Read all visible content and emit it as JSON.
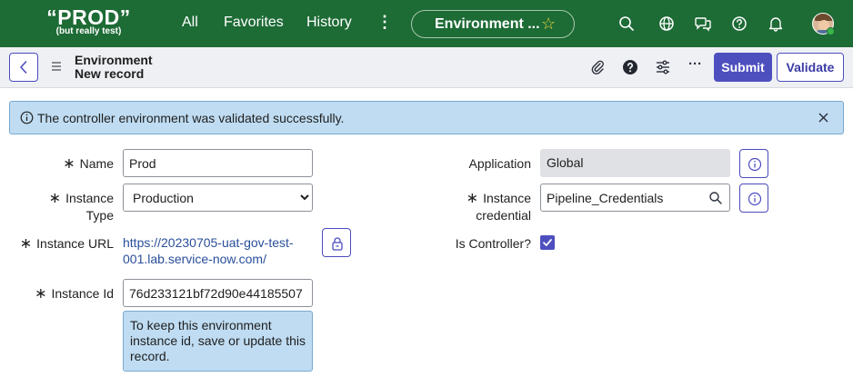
{
  "app": {
    "logo_main": "“PROD”",
    "logo_sub": "(but really test)"
  },
  "nav": {
    "all": "All",
    "favorites": "Favorites",
    "history": "History",
    "more": "⋮",
    "context_title": "Environment ...",
    "context_star": "☆"
  },
  "header": {
    "record_type": "Environment",
    "record_state": "New record",
    "submit": "Submit",
    "validate": "Validate",
    "more": "···"
  },
  "notice": {
    "message": "The controller environment was validated successfully."
  },
  "form": {
    "name": {
      "label": "Name",
      "value": "Prod"
    },
    "instance_type": {
      "label_line1": "Instance",
      "label_line2": "Type",
      "selected": "Production"
    },
    "instance_url": {
      "label": "Instance URL",
      "link": "https://20230705-uat-gov-test-001.lab.service-now.com/"
    },
    "instance_id": {
      "label": "Instance Id",
      "value": "76d233121bf72d90e44185507",
      "hint": "To keep this environment instance id, save or update this record."
    },
    "application": {
      "label": "Application",
      "value": "Global"
    },
    "instance_credential": {
      "label_line1": "Instance",
      "label_line2": "credential",
      "value": "Pipeline_Credentials"
    },
    "is_controller": {
      "label": "Is Controller?",
      "checked": true
    }
  },
  "required_mark": "∗",
  "colors": {
    "banner": "#1d6b35",
    "accent": "#4e4fbf",
    "notice_bg": "#bfdcf2",
    "link": "#2a4f9b"
  }
}
